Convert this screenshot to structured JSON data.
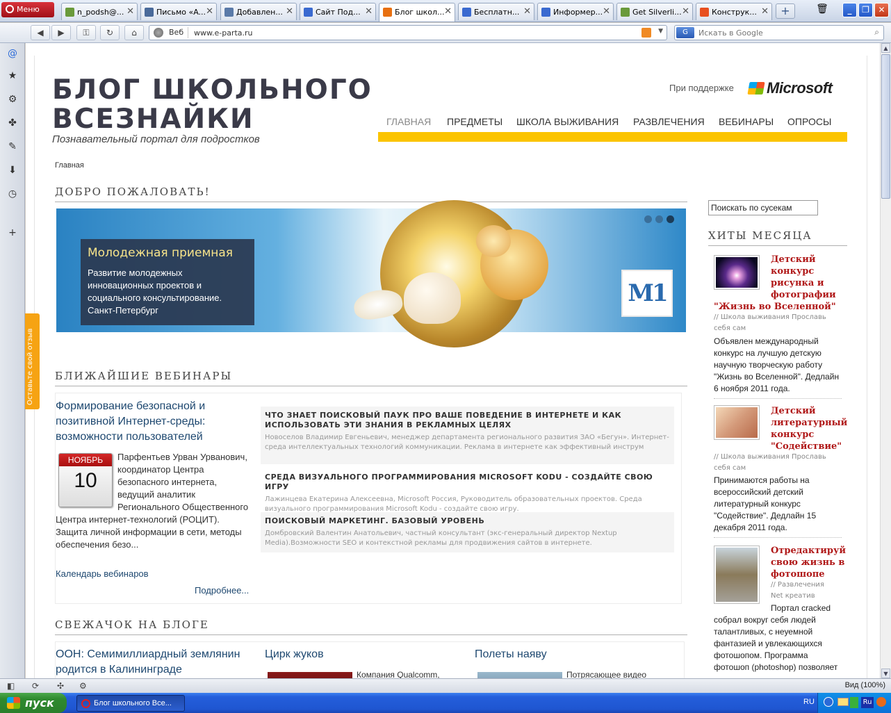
{
  "browser": {
    "menu_label": "Меню",
    "tabs": [
      {
        "label": "n_podsh@...",
        "active": false
      },
      {
        "label": "Письмо «A...",
        "active": false
      },
      {
        "label": "Добавлен...",
        "active": false
      },
      {
        "label": "Сайт Под...",
        "active": false
      },
      {
        "label": "Блог школ...",
        "active": true
      },
      {
        "label": "Бесплатн...",
        "active": false
      },
      {
        "label": "Информер...",
        "active": false
      },
      {
        "label": "Get Silverli...",
        "active": false
      },
      {
        "label": "Конструк...",
        "active": false
      }
    ],
    "address_label": "Веб",
    "url": "www.e-parta.ru",
    "search_engine_label": "G",
    "search_placeholder": "Искать в Google",
    "zoom": "Вид (100%)"
  },
  "feedback_tab": "Оставьте свой отзыв",
  "site": {
    "logo_line1": "БЛОГ ШКОЛЬНОГО",
    "logo_line2": "ВСЕЗНАЙКИ",
    "tagline": "Познавательный портал для подростков",
    "support_text": "При поддержке",
    "sponsor": "Microsoft",
    "nav": [
      "ГЛАВНАЯ",
      "ПРЕДМЕТЫ",
      "ШКОЛА ВЫЖИВАНИЯ",
      "РАЗВЛЕЧЕНИЯ",
      "ВЕБИНАРЫ",
      "ОПРОСЫ"
    ],
    "breadcrumb": "Главная",
    "welcome_title": "ДОБРО ПОЖАЛОВАТЬ!",
    "banner": {
      "title": "Молодежная приемная",
      "text": "Развитие молодежных инновационных проектов и социального консультирование. Санкт-Петербург",
      "badge": "М1"
    },
    "webinars_title": "БЛИЖАЙШИЕ ВЕБИНАРЫ",
    "webinar_main": {
      "title": "Формирование безопасной и позитивной Интернет-среды: возможности пользователей",
      "month": "НОЯБРЬ",
      "day": "10",
      "description": "Парфентьев Урван Урванович, координатор Центра безопасного интернета, ведущий аналитик Регионального Общественного Центра интернет-технологий (РОЦИТ). Защита личной информации в сети, методы обеспечения безо...",
      "calendar_link": "Календарь вебинаров",
      "more_link": "Подробнее..."
    },
    "webinar_list": [
      {
        "title": "ЧТО ЗНАЕТ ПОИСКОВЫЙ ПАУК ПРО ВАШЕ ПОВЕДЕНИЕ В ИНТЕРНЕТЕ И КАК ИСПОЛЬЗОВАТЬ ЭТИ ЗНАНИЯ В РЕКЛАМНЫХ ЦЕЛЯХ",
        "desc": "Новоселов Владимир Евгеньевич, менеджер департамента регионального развития ЗАО «Бегун». Интернет-среда интеллектуальных технологий коммуникации. Реклама в интернете как эффективный инструм"
      },
      {
        "title": "СРЕДА ВИЗУАЛЬНОГО ПРОГРАММИРОВАНИЯ MICROSOFT KODU - СОЗДАЙТЕ СВОЮ ИГРУ",
        "desc": "Лажинцева Екатерина Алексеевна, Microsoft Россия, Руководитель образовательных проектов. Среда визуального программирования Microsoft Kodu - создайте свою игру."
      },
      {
        "title": "ПОИСКОВЫЙ МАРКЕТИНГ. БАЗОВЫЙ УРОВЕНЬ",
        "desc": "Домбровский Валентин Анатольевич, частный консультант (экс-генеральный директор Nextup Media).Возможности SEO и контекстной рекламы для продвижения сайтов в интернете."
      }
    ],
    "fresh_title": "СВЕЖАЧОК НА БЛОГЕ",
    "fresh": [
      {
        "title": "ООН: Семимиллиардный землянин родится в Калининграде",
        "text": ""
      },
      {
        "title": "Цирк жуков",
        "text": "Компания Qualcomm,"
      },
      {
        "title": "Полеты наяву",
        "text": "Потрясающее видео"
      }
    ],
    "sidebar": {
      "search_value": "Поискать по сусекам",
      "hits_title": "ХИТЫ МЕСЯЦА",
      "hits": [
        {
          "title": "Детский конкурс рисунка и фотографии \"Жизнь во Вселенной\"",
          "title_lines": [
            "Детский",
            "конкурс",
            "рисунка и",
            "фотографии"
          ],
          "title_tail": "\"Жизнь во Вселенной\"",
          "meta1": "// Школа выживания  Прославь",
          "meta2": "себя сам",
          "text": "Объявлен международный конкурс на лучшую детскую научную творческую работу \"Жизнь во Вселенной\". Дедлайн 6 ноября 2011 года."
        },
        {
          "title": "Детский литературный конкурс \"Содействие\"",
          "title_lines": [
            "Детский",
            "литературный",
            "конкурс",
            "\"Содействие\""
          ],
          "title_tail": "",
          "meta1": "// Школа выживания  Прославь",
          "meta2": "себя сам",
          "text": "Принимаются работы на всероссийский детский литературный конкурс \"Содействие\". Дедлайн 15 декабря 2011 года."
        },
        {
          "title": "Отредактируй свою жизнь в фотошопе",
          "title_lines": [
            "Отредактируй",
            "свою жизнь в",
            "фотошопе"
          ],
          "title_tail": "",
          "meta1": "// Развлечения",
          "meta2": "Net креатив",
          "text": "Портал cracked собрал вокруг себя людей талантливых, с неуемной фантазией и увлекающихся фотошопом. Программа фотошоп (photoshop) позволяет"
        }
      ]
    }
  },
  "taskbar": {
    "start_label": "пуск",
    "window_title": "Блог школьного Все...",
    "lang": "RU",
    "tray_lang": "Ru"
  },
  "colors": {
    "accent_yellow": "#fbc400",
    "link_blue": "#1e4870",
    "hit_red": "#b01818"
  }
}
